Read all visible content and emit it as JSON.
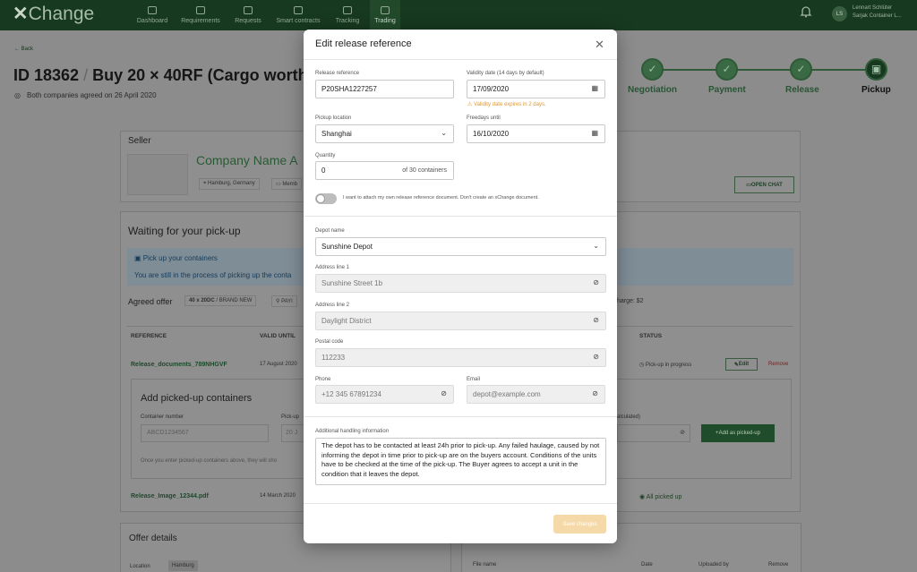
{
  "app": {
    "logo_x": "✕",
    "logo": "Change"
  },
  "nav": [
    {
      "label": "Dashboard"
    },
    {
      "label": "Requirements"
    },
    {
      "label": "Requests"
    },
    {
      "label": "Smart contracts"
    },
    {
      "label": "Tracking"
    },
    {
      "label": "Trading"
    }
  ],
  "user": {
    "name": "Lennart Schlüter",
    "company": "Sarjak Container L...",
    "initials": "LS"
  },
  "page": {
    "back": "Back",
    "title": "ID 18362",
    "title_sep": "/",
    "title_rest": "Buy 20 × 40RF (Cargo worthy) i",
    "subtitle": "Both companies agreed on 26 April 2020",
    "steps": [
      {
        "label": "Negotiation"
      },
      {
        "label": "Payment"
      },
      {
        "label": "Release"
      },
      {
        "label": "Pickup"
      }
    ],
    "seller": "Seller",
    "company": "Company Name A",
    "location": "Hamburg, Germany",
    "member": "Memb",
    "open_chat": "OPEN CHAT",
    "waiting": "Waiting for your pick-up",
    "pickup_title": "Pick up your containers",
    "pickup_text": "You are still in the process of picking up the conta",
    "agreed_offer": "Agreed offer",
    "offer_badge_a": "40 x 20DC",
    "offer_badge_b": "/ BRAND NEW",
    "offer_badge_pay": "PAYI",
    "charge": "harge: $2",
    "col_reference": "REFERENCE",
    "col_valid": "VALID UNTIL",
    "col_status": "STATUS",
    "row1_ref": "Release_documents_789NHGVF",
    "row1_date": "17 August 2020",
    "row1_status": "Pick-up in progress",
    "edit": "Edit",
    "remove": "Remove",
    "add_picked": "Add picked-up containers",
    "container_number": "Container number",
    "container_placeholder": "ABCD1234567",
    "pickup_col": "Pick-up",
    "pickup_ph": "20 J",
    "calculated": "alculated)",
    "add_as_picked": "Add as picked-up",
    "hint": "Once you enter picked-up containers above, they will sho",
    "row2_ref": "Release_Image_12344.pdf",
    "row2_date": "14 March 2020",
    "row2_status": "All picked up",
    "offer_details": "Offer details",
    "location_label": "Location",
    "location_value": "Hamburg",
    "file_name": "File name",
    "date_col": "Date",
    "uploaded_by": "Uploaded by",
    "remove_col": "Remove"
  },
  "modal": {
    "title": "Edit release reference",
    "release_ref_label": "Release reference",
    "release_ref_value": "P20SHA1227257",
    "validity_label": "Validity date (14 days by default)",
    "validity_value": "17/09/2020",
    "validity_warning": "Validity date expires in 2 days.",
    "pickup_loc_label": "Pickup location",
    "pickup_loc_value": "Shanghai",
    "freedays_label": "Freedays until",
    "freedays_value": "16/10/2020",
    "quantity_label": "Quantity",
    "quantity_value": "0",
    "quantity_suffix": "of 30 containers",
    "toggle_label": "I want to attach my own release reference document. Don't create an xChange document.",
    "depot_label": "Depot name",
    "depot_value": "Sunshine Depot",
    "addr1_label": "Address line 1",
    "addr1_value": "Sunshine Street 1b",
    "addr2_label": "Address line 2",
    "addr2_value": "Daylight District",
    "postal_label": "Postal code",
    "postal_value": "112233",
    "phone_label": "Phone",
    "phone_value": "+12 345 67891234",
    "email_label": "Email",
    "email_value": "depot@example.com",
    "handling_label": "Additional handling information",
    "handling_value": "The depot has to be contacted at least 24h prior to pick-up. Any failed haulage, caused by not informing the depot in time prior to pick-up are on the buyers account. Conditions of the units have to be checked at the time of the pick-up. The Buyer agrees to accept a unit in the condition that it leaves the depot.",
    "save": "Save changes"
  }
}
